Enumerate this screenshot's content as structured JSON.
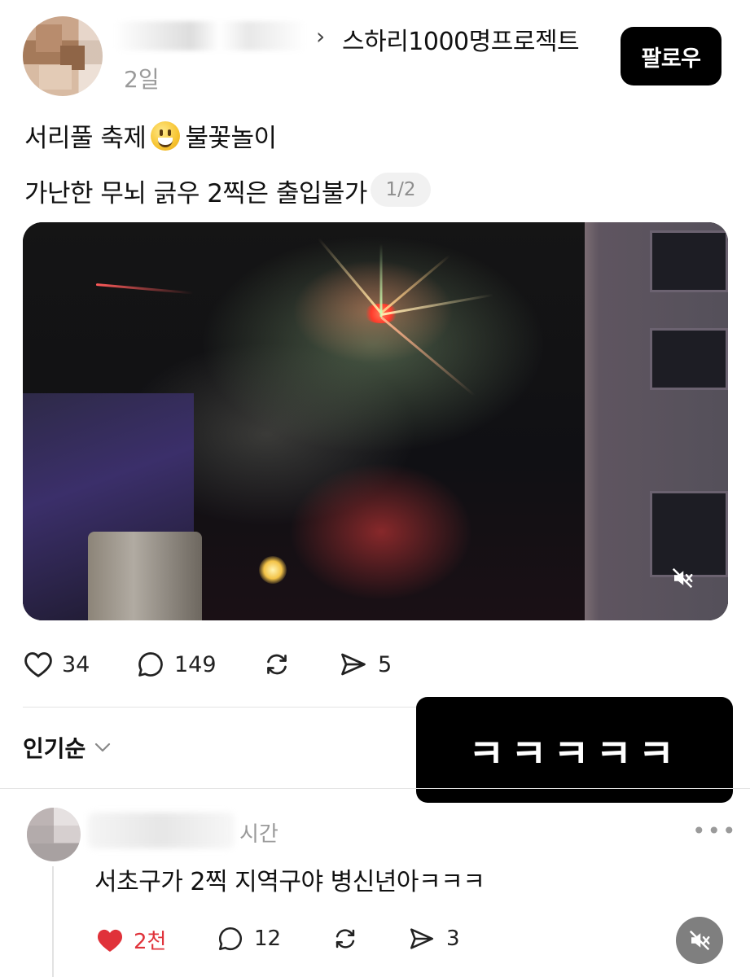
{
  "post": {
    "community": "스하리1000명프로젝트",
    "breadcrumb_separator": "›",
    "time": "2일",
    "follow_label": "팔로우",
    "text_line1_a": "서리풀 축제",
    "text_line1_b": "불꽃놀이",
    "text_line2": "가난한 무뇌 긁우 2찍은 출입불가",
    "pager": "1/2",
    "likes": "34",
    "comments": "149",
    "shares": "5"
  },
  "sort": {
    "label": "인기순"
  },
  "overlay_caption": "ㅋㅋㅋㅋㅋ",
  "comment": {
    "time": "시간",
    "more": "•••",
    "text": "서초구가 2찍 지역구야 병신년아ㅋㅋㅋ",
    "likes": "2천",
    "comments": "12",
    "shares": "3"
  },
  "colors": {
    "like_active": "#e0323a",
    "button_bg": "#000000"
  }
}
